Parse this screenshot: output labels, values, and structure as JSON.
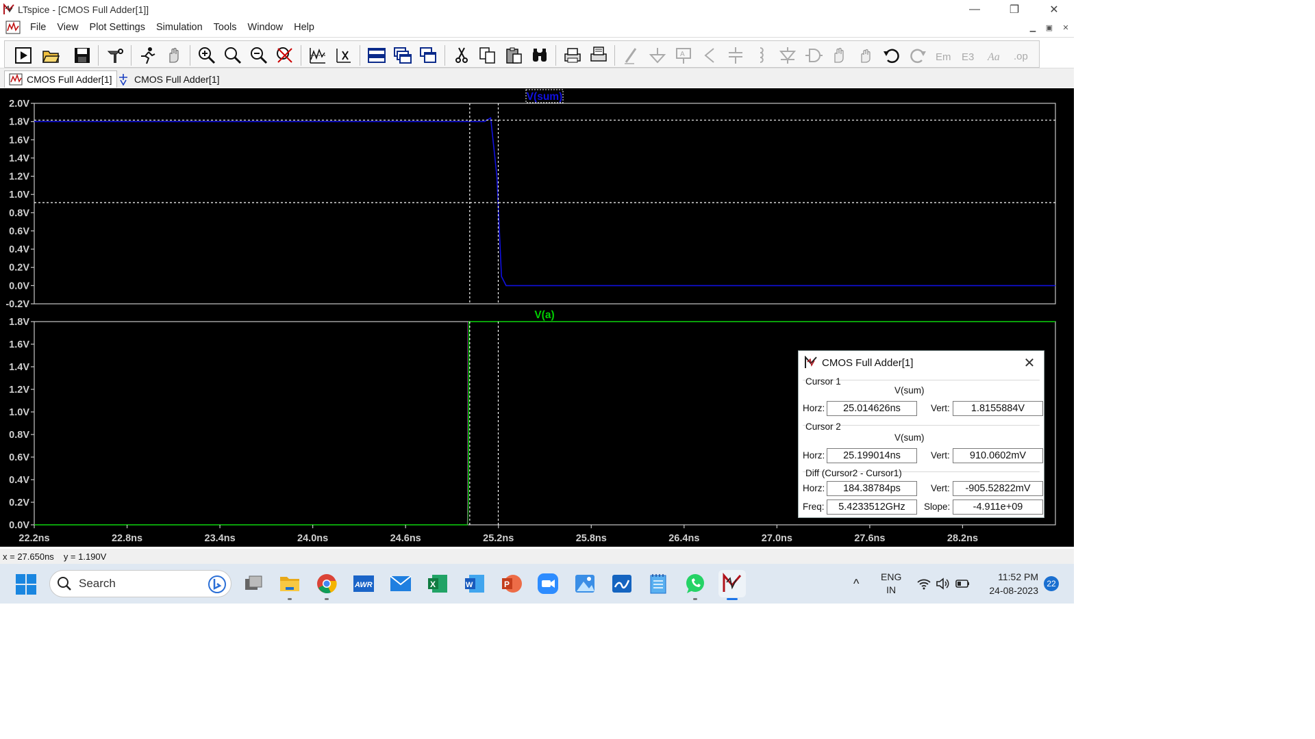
{
  "window": {
    "title": "LTspice - [CMOS Full Adder[1]]",
    "minimize": "—",
    "restore": "❐",
    "close": "✕"
  },
  "menu": {
    "items": [
      "File",
      "View",
      "Plot Settings",
      "Simulation",
      "Tools",
      "Window",
      "Help"
    ],
    "mdi_min": "▁",
    "mdi_restore": "▣",
    "mdi_close": "✕"
  },
  "toolbar": {
    "icons": [
      "run-icon",
      "open-icon",
      "save-icon",
      "control-panel-icon",
      "halt-icon",
      "pan-icon",
      "zoom-in-icon",
      "zoom-area-icon",
      "zoom-out-icon",
      "zoom-fit-icon",
      "autorange-icon",
      "mark-icon",
      "tile-h-icon",
      "cascade-icon",
      "tile-v-icon",
      "cut-icon",
      "copy-icon",
      "paste-icon",
      "find-icon",
      "print-icon",
      "print-preview-icon",
      "wire-icon",
      "ground-icon",
      "label-icon",
      "resistor-icon",
      "capacitor-icon",
      "inductor-icon",
      "diode-icon",
      "component-icon",
      "move-icon",
      "drag-icon",
      "undo-icon",
      "redo-icon",
      "rotate-icon",
      "mirror-icon",
      "text-icon",
      "spice-directive-icon"
    ]
  },
  "tabs": [
    {
      "label": "CMOS Full Adder[1]",
      "icon": "waveform-icon",
      "active": true
    },
    {
      "label": "CMOS Full Adder[1]",
      "icon": "schematic-icon",
      "active": false
    }
  ],
  "plot": {
    "background": "#000000",
    "pane1": {
      "trace_label": "V(sum)",
      "trace_color": "#1010e0",
      "y_ticks": [
        "2.0V",
        "1.8V",
        "1.6V",
        "1.4V",
        "1.2V",
        "1.0V",
        "0.8V",
        "0.6V",
        "0.4V",
        "0.2V",
        "0.0V",
        "-0.2V"
      ]
    },
    "pane2": {
      "trace_label": "V(a)",
      "trace_color": "#00c800",
      "y_ticks": [
        "1.8V",
        "1.6V",
        "1.4V",
        "1.2V",
        "1.0V",
        "0.8V",
        "0.6V",
        "0.4V",
        "0.2V",
        "0.0V"
      ]
    },
    "x_ticks": [
      "22.2ns",
      "22.8ns",
      "23.4ns",
      "24.0ns",
      "24.6ns",
      "25.2ns",
      "25.8ns",
      "26.4ns",
      "27.0ns",
      "27.6ns",
      "28.2ns"
    ]
  },
  "chart_data": [
    {
      "type": "line",
      "title": "V(sum)",
      "xlabel": "",
      "ylabel": "",
      "xlim": [
        22.2,
        28.8
      ],
      "ylim": [
        -0.2,
        2.0
      ],
      "grid": false,
      "series": [
        {
          "name": "V(sum)",
          "x": [
            22.2,
            24.96,
            25.11,
            25.15,
            25.19,
            25.22,
            25.25,
            28.8
          ],
          "y": [
            1.8,
            1.8,
            1.8,
            1.84,
            1.2,
            0.1,
            0.0,
            0.0
          ]
        }
      ],
      "cursors": [
        {
          "name": "Cursor 1",
          "x": 25.014626,
          "y": 1.8155884
        },
        {
          "name": "Cursor 2",
          "x": 25.199014,
          "y": 0.9100602
        }
      ]
    },
    {
      "type": "line",
      "title": "V(a)",
      "xlabel": "",
      "ylabel": "",
      "xlim": [
        22.2,
        28.8
      ],
      "ylim": [
        0.0,
        1.8
      ],
      "grid": false,
      "series": [
        {
          "name": "V(a)",
          "x": [
            22.2,
            25.0,
            25.005,
            25.01,
            28.8
          ],
          "y": [
            0.0,
            0.0,
            0.2,
            1.8,
            1.8
          ]
        }
      ]
    }
  ],
  "status": {
    "x": "x = 27.650ns",
    "y": "y = 1.190V"
  },
  "cursor_dialog": {
    "title": "CMOS Full Adder[1]",
    "cursor1_header": "Cursor 1",
    "cursor1_trace": "V(sum)",
    "cursor1_horz_label": "Horz:",
    "cursor1_horz": "25.014626ns",
    "cursor1_vert_label": "Vert:",
    "cursor1_vert": "1.8155884V",
    "cursor2_header": "Cursor 2",
    "cursor2_trace": "V(sum)",
    "cursor2_horz_label": "Horz:",
    "cursor2_horz": "25.199014ns",
    "cursor2_vert_label": "Vert:",
    "cursor2_vert": "910.0602mV",
    "diff_header": "Diff (Cursor2 - Cursor1)",
    "diff_horz_label": "Horz:",
    "diff_horz": "184.38784ps",
    "diff_vert_label": "Vert:",
    "diff_vert": "-905.52822mV",
    "freq_label": "Freq:",
    "freq": "5.4233512GHz",
    "slope_label": "Slope:",
    "slope": "-4.911e+09",
    "close": "✕"
  },
  "taskbar": {
    "search_placeholder": "Search",
    "apps": [
      "task-view-icon",
      "file-explorer-icon",
      "chrome-icon",
      "awr-icon",
      "mail-icon",
      "excel-icon",
      "word-icon",
      "powerpoint-icon",
      "zoom-icon",
      "photos-icon",
      "whiteboard-icon",
      "notepad-icon",
      "whatsapp-icon",
      "ltspice-icon"
    ],
    "awr_label": "AWR",
    "excel_label": "X",
    "word_label": "W",
    "ppt_label": "P",
    "lang_line1": "ENG",
    "lang_line2": "IN",
    "time": "11:52 PM",
    "date": "24-08-2023",
    "notifications": "22",
    "tray_chevron": "^"
  }
}
